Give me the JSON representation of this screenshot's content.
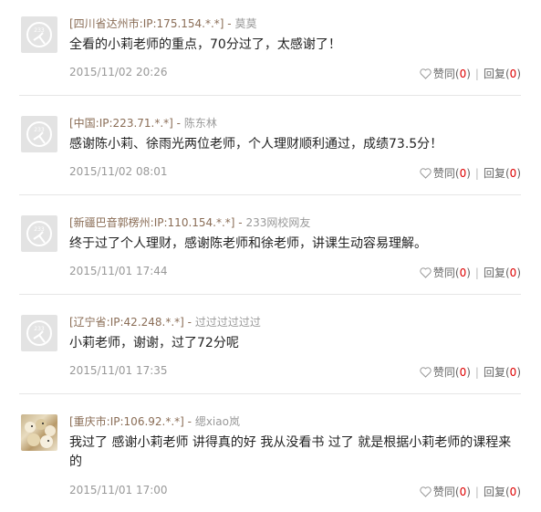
{
  "comments": [
    {
      "location": "[四川省达州市:IP:175.154.*.*]",
      "separator": " - ",
      "username": "莫莫",
      "content": "全看的小莉老师的重点，70分过了，太感谢了！",
      "time": "2015/11/02 20:26",
      "like_label": "赞同",
      "like_count": "0",
      "reply_label": "回复",
      "reply_count": "0",
      "avatar": "default-233-avatar"
    },
    {
      "location": "[中国:IP:223.71.*.*]",
      "separator": " - ",
      "username": "陈东林",
      "content": "感谢陈小莉、徐雨光两位老师，个人理财顺利通过，成绩73.5分！",
      "time": "2015/11/02 08:01",
      "like_label": "赞同",
      "like_count": "0",
      "reply_label": "回复",
      "reply_count": "0",
      "avatar": "default-233-avatar"
    },
    {
      "location": "[新疆巴音郭楞州:IP:110.154.*.*]",
      "separator": " - ",
      "username": "233网校网友",
      "content": "终于过了个人理财，感谢陈老师和徐老师，讲课生动容易理解。",
      "time": "2015/11/01 17:44",
      "like_label": "赞同",
      "like_count": "0",
      "reply_label": "回复",
      "reply_count": "0",
      "avatar": "default-233-avatar"
    },
    {
      "location": "[辽宁省:IP:42.248.*.*]",
      "separator": " - ",
      "username": "过过过过过过",
      "content": "小莉老师，谢谢，过了72分呢",
      "time": "2015/11/01 17:35",
      "like_label": "赞同",
      "like_count": "0",
      "reply_label": "回复",
      "reply_count": "0",
      "avatar": "default-233-avatar"
    },
    {
      "location": "[重庆市:IP:106.92.*.*]",
      "separator": " - ",
      "username": "缌xiao岚",
      "content": "我过了 感谢小莉老师 讲得真的好 我从没看书 过了 就是根据小莉老师的课程来的",
      "time": "2015/11/01 17:00",
      "like_label": "赞同",
      "like_count": "0",
      "reply_label": "回复",
      "reply_count": "0",
      "avatar": "photo-avatar"
    }
  ],
  "colors": {
    "location": "#8a6d56",
    "username": "#999999",
    "count": "#dd0000",
    "time": "#999999"
  },
  "icons": {
    "like": "heart-outline-icon"
  }
}
